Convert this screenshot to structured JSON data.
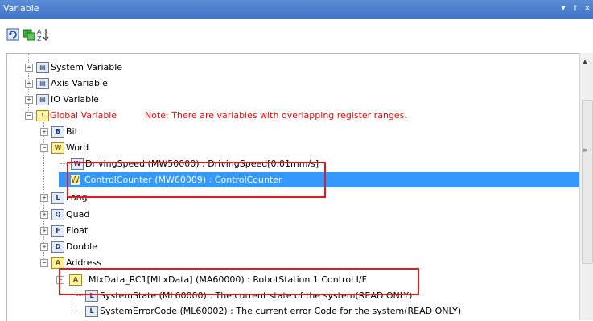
{
  "panel": {
    "title": "Variable",
    "controls": [
      "▾",
      "†",
      "×"
    ]
  },
  "toolbar": {
    "buttons": [
      "refresh",
      "monitor",
      "sort"
    ]
  },
  "tree": {
    "system_variable": "System Variable",
    "axis_variable": "Axis Variable",
    "io_variable": "IO Variable",
    "global_variable": "Global Variable",
    "global_note": "Note: There are variables with overlapping register ranges.",
    "bit": "Bit",
    "word": "Word",
    "driving_speed": "DrivingSpeed (MW50000) : DrivingSpeed[0.01mm/s]",
    "control_counter": "ControlCounter (MW60009) : ControlCounter",
    "long": "Long",
    "quad": "Quad",
    "float": "Float",
    "double": "Double",
    "address": "Address",
    "mlxdata": "MlxData_RC1[MLxData] (MA60000) : RobotStation 1 Control I/F",
    "system_state": "SystemState (ML60000) : The current state of the system(READ ONLY)",
    "system_error_code": "SystemErrorCode (ML60002) : The current error Code for the system(READ ONLY)"
  },
  "icons": {
    "bit": "B",
    "word": "W",
    "long": "L",
    "quad": "Q",
    "float": "F",
    "double": "D",
    "address": "A",
    "member": "L"
  },
  "colors": {
    "selection": "#3399ff",
    "warning_text": "#ff0000",
    "highlight_box": "#e01b1b",
    "titlebar": "#4a7fcf"
  }
}
